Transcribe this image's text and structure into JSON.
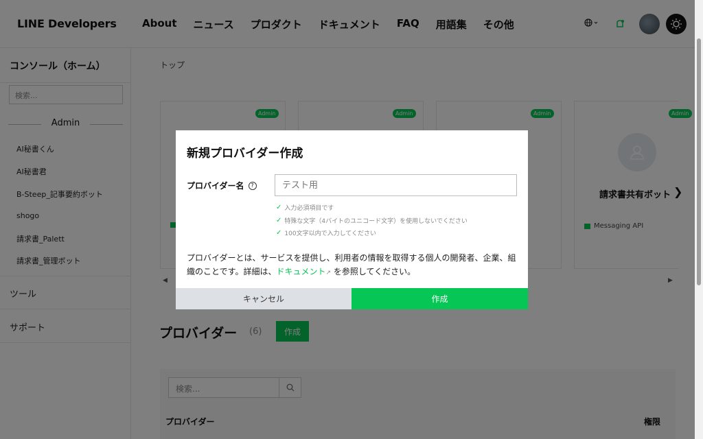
{
  "header": {
    "logo": "LINE Developers",
    "nav": [
      "About",
      "ニュース",
      "プロダクト",
      "ドキュメント",
      "FAQ",
      "用語集",
      "その他"
    ]
  },
  "sidebar": {
    "title": "コンソール（ホーム）",
    "search_placeholder": "検索...",
    "group": "Admin",
    "items": [
      "AI秘書くん",
      "AI秘書君",
      "B-Steep_記事要約ボット",
      "shogo",
      "請求書_Palett",
      "請求書_管理ボット"
    ],
    "tools": "ツール",
    "support": "サポート"
  },
  "breadcrumb": "トップ",
  "cards": {
    "badge": "Admin",
    "visible_card": {
      "name": "請求書共有ボット",
      "tag": "Messaging API"
    }
  },
  "providers": {
    "title": "プロバイダー",
    "count": "(6)",
    "create_label": "作成",
    "search_placeholder": "検索...",
    "col_provider": "プロバイダー",
    "col_role": "権限"
  },
  "modal": {
    "title": "新規プロバイダー作成",
    "field_label": "プロバイダー名",
    "field_value": "テスト用",
    "rules": [
      "入力必須項目です",
      "特殊な文字（4バイトのユニコード文字）を使用しないでください",
      "100文字以内で入力してください"
    ],
    "desc_before": "プロバイダーとは、サービスを提供し、利用者の情報を取得する個人の開発者、企業、組織のことです。詳細は、",
    "desc_link": "ドキュメント",
    "desc_after": " を参照してください。",
    "cancel": "キャンセル",
    "create": "作成"
  },
  "colors": {
    "accent": "#06c755",
    "overlay": "rgba(0,0,0,0.5)"
  }
}
